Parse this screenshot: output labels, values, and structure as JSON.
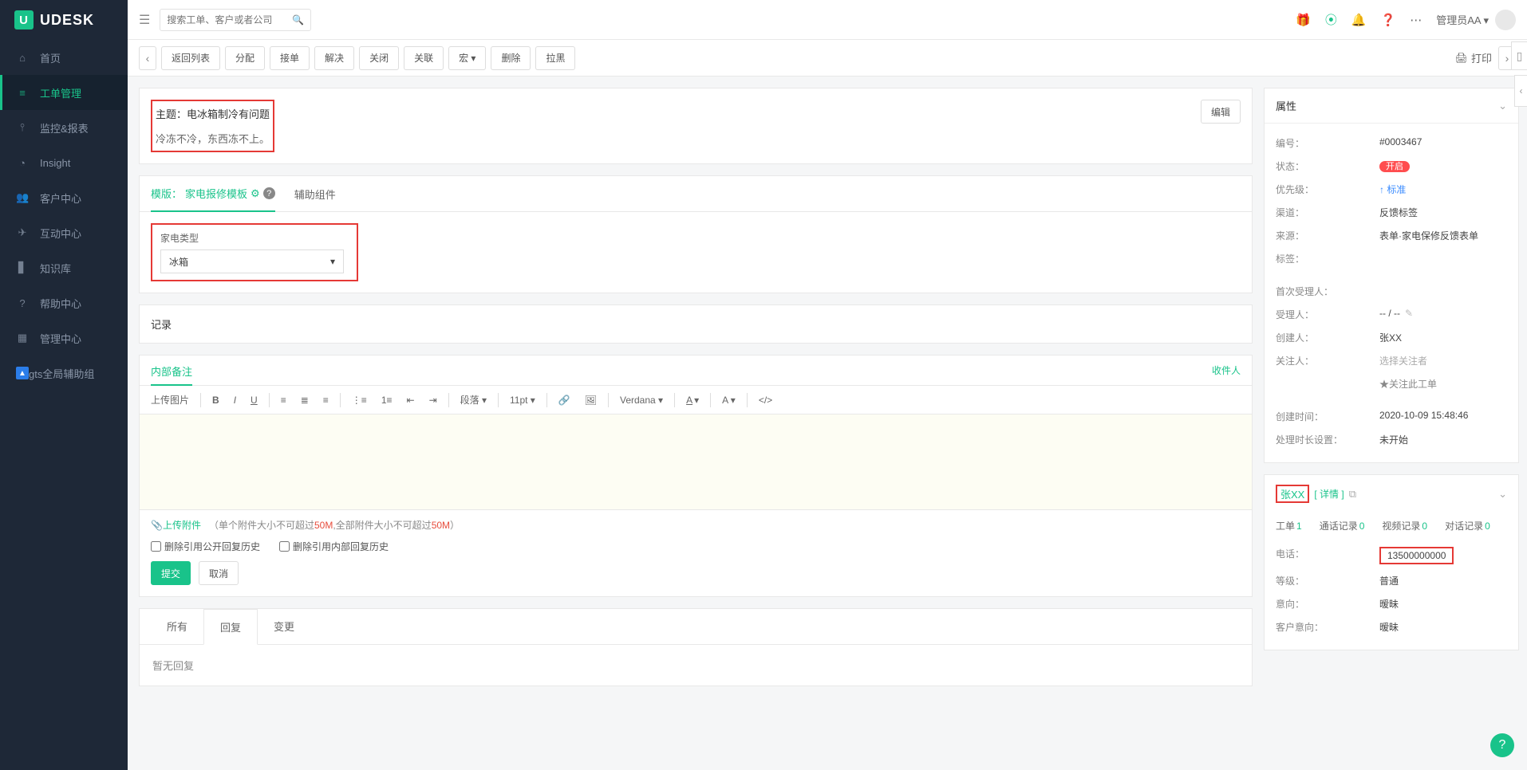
{
  "brand": "UDESK",
  "search_placeholder": "搜索工单、客户或者公司",
  "nav": [
    {
      "icon": "⌂",
      "label": "首页"
    },
    {
      "icon": "≡",
      "label": "工单管理",
      "active": true
    },
    {
      "icon": "⫯",
      "label": "监控&报表"
    },
    {
      "icon": "◔",
      "label": "Insight"
    },
    {
      "icon": "👥",
      "label": "客户中心"
    },
    {
      "icon": "✈",
      "label": "互动中心"
    },
    {
      "icon": "▋",
      "label": "知识库"
    },
    {
      "icon": "?",
      "label": "帮助中心"
    },
    {
      "icon": "▦",
      "label": "管理中心"
    },
    {
      "icon": "▲",
      "label": "gts全局辅助组",
      "child": true
    }
  ],
  "user_label": "管理员AA ▾",
  "toolbar": {
    "buttons": [
      "返回列表",
      "分配",
      "接单",
      "解决",
      "关闭",
      "关联",
      "宏 ▾",
      "删除",
      "拉黑"
    ],
    "print": "打印"
  },
  "ticket": {
    "subject_prefix": "主题：",
    "subject": "电冰箱制冷有问题",
    "body": "冷冻不冷，东西冻不上。",
    "edit": "编辑"
  },
  "template": {
    "tab_prefix": "模版：",
    "tab_name": "家电报修模板",
    "aux_tab": "辅助组件",
    "field_label": "家电类型",
    "field_value": "冰箱"
  },
  "record_title": "记录",
  "note": {
    "tab": "内部备注",
    "recipients": "收件人",
    "toolbar": {
      "upload": "上传图片",
      "para": "段落 ▾",
      "size": "11pt ▾",
      "font": "Verdana ▾"
    },
    "attach_link": "上传附件",
    "attach_hint_1": "（单个附件大小不可超过",
    "attach_hint_2": ",全部附件大小不可超过",
    "attach_limit": "50M",
    "attach_hint_3": "）",
    "chk1": "删除引用公开回复历史",
    "chk2": "删除引用内部回复历史",
    "submit": "提交",
    "cancel": "取消"
  },
  "history": {
    "tabs": [
      "所有",
      "回复",
      "变更"
    ],
    "empty": "暂无回复"
  },
  "props": {
    "title": "属性",
    "rows": {
      "id_k": "编号：",
      "id_v": "#0003467",
      "status_k": "状态：",
      "status_v": "开启",
      "prio_k": "优先级：",
      "prio_v": "标准",
      "channel_k": "渠道：",
      "channel_v": "反馈标签",
      "source_k": "来源：",
      "source_v": "表单·家电保修反馈表单",
      "tags_k": "标签：",
      "tags_v": "",
      "first_k": "首次受理人：",
      "first_v": "",
      "assignee_k": "受理人：",
      "assignee_v": "-- / --",
      "creator_k": "创建人：",
      "creator_v": "张XX",
      "follower_k": "关注人：",
      "follower_v": "选择关注者",
      "star": "★关注此工单",
      "created_k": "创建时间：",
      "created_v": "2020-10-09 15:48:46",
      "sla_k": "处理时长设置：",
      "sla_v": "未开始"
    }
  },
  "customer": {
    "name": "张XX",
    "detail": "[ 详情 ]",
    "stats": {
      "t1": "工单",
      "t1n": "1",
      "t2": "通话记录",
      "t2n": "0",
      "t3": "视频记录",
      "t3n": "0",
      "t4": "对话记录",
      "t4n": "0"
    },
    "rows": {
      "phone_k": "电话：",
      "phone_v": "13500000000",
      "level_k": "等级：",
      "level_v": "普通",
      "intent_k": "意向：",
      "intent_v": "暧昧",
      "cintent_k": "客户意向：",
      "cintent_v": "暧昧"
    }
  }
}
